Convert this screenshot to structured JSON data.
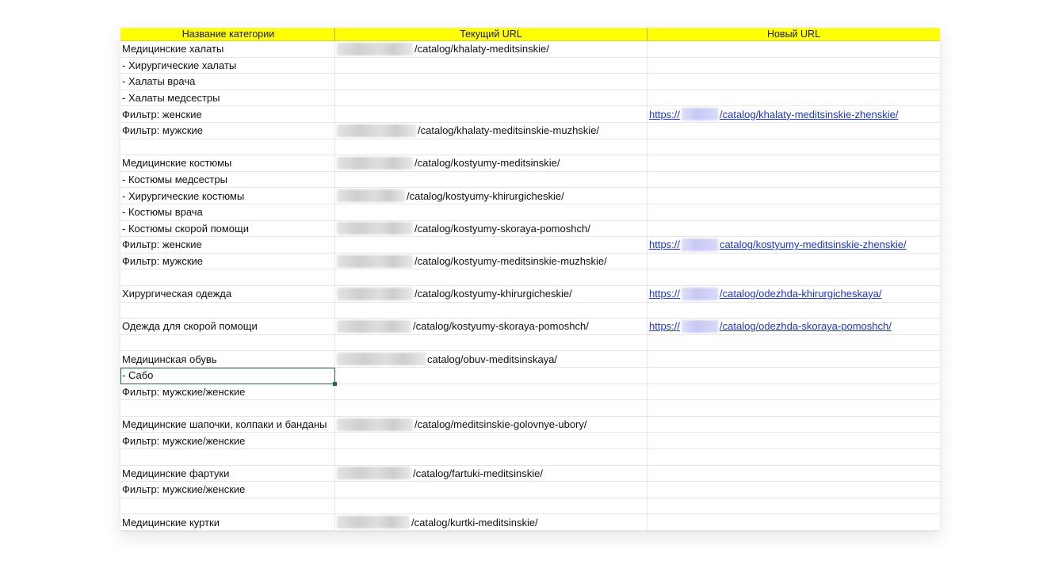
{
  "headers": {
    "col1": "Название категории",
    "col2": "Текущий URL",
    "col3": "Новый URL"
  },
  "rows": [
    {
      "name": "Медицинские халаты",
      "current_url": "/catalog/khalaty-meditsinskie/",
      "new_url": ""
    },
    {
      "name": " - Хирургические халаты",
      "current_url": "",
      "new_url": ""
    },
    {
      "name": " - Халаты врача",
      "current_url": "",
      "new_url": ""
    },
    {
      "name": " - Халаты медсестры",
      "current_url": "",
      "new_url": ""
    },
    {
      "name": "Фильтр: женские",
      "current_url": "",
      "new_url_prefix": "https://",
      "new_url": "/catalog/khalaty-meditsinskie-zhenskie/"
    },
    {
      "name": "Фильтр: мужские",
      "current_url": "/catalog/khalaty-meditsinskie-muzhskie/",
      "new_url": ""
    },
    {
      "name": "",
      "current_url": "",
      "new_url": ""
    },
    {
      "name": "Медицинские костюмы",
      "current_url": "/catalog/kostyumy-meditsinskie/",
      "new_url": ""
    },
    {
      "name": " - Костюмы медсестры",
      "current_url": "",
      "new_url": ""
    },
    {
      "name": " - Хирургические костюмы",
      "current_url": "/catalog/kostyumy-khirurgicheskie/",
      "new_url": ""
    },
    {
      "name": " - Костюмы врача",
      "current_url": "",
      "new_url": ""
    },
    {
      "name": " - Костюмы скорой помощи",
      "current_url": "/catalog/kostyumy-skoraya-pomoshch/",
      "new_url": ""
    },
    {
      "name": "Фильтр: женские",
      "current_url": "",
      "new_url_prefix": "https://",
      "new_url": "catalog/kostyumy-meditsinskie-zhenskie/"
    },
    {
      "name": "Фильтр: мужские",
      "current_url": "/catalog/kostyumy-meditsinskie-muzhskie/",
      "new_url": ""
    },
    {
      "name": "",
      "current_url": "",
      "new_url": ""
    },
    {
      "name": "Хирургическая одежда",
      "current_url": "/catalog/kostyumy-khirurgicheskie/",
      "new_url_prefix": "https://",
      "new_url": "/catalog/odezhda-khirurgicheskaya/"
    },
    {
      "name": "",
      "current_url": "",
      "new_url": ""
    },
    {
      "name": "Одежда для скорой помощи",
      "current_url": "/catalog/kostyumy-skoraya-pomoshch/",
      "new_url_prefix": "https://",
      "new_url": "/catalog/odezhda-skoraya-pomoshch/"
    },
    {
      "name": "",
      "current_url": "",
      "new_url": ""
    },
    {
      "name": "Медицинская обувь",
      "current_url": "catalog/obuv-meditsinskaya/",
      "new_url": ""
    },
    {
      "name": " - Сабо",
      "current_url": "",
      "new_url": ""
    },
    {
      "name": "Фильтр: мужские/женские",
      "current_url": "",
      "new_url": ""
    },
    {
      "name": "",
      "current_url": "",
      "new_url": ""
    },
    {
      "name": "Медицинские шапочки, колпаки и банданы",
      "current_url": "/catalog/meditsinskie-golovnye-ubory/",
      "new_url": ""
    },
    {
      "name": "Фильтр: мужские/женские",
      "current_url": "",
      "new_url": ""
    },
    {
      "name": "",
      "current_url": "",
      "new_url": ""
    },
    {
      "name": "Медицинские фартуки",
      "current_url": "/catalog/fartuki-meditsinskie/",
      "new_url": ""
    },
    {
      "name": "Фильтр: мужские/женские",
      "current_url": "",
      "new_url": ""
    },
    {
      "name": "",
      "current_url": "",
      "new_url": ""
    },
    {
      "name": "Медицинские куртки",
      "current_url": "/catalog/kurtki-meditsinskie/",
      "new_url": ""
    }
  ],
  "colors": {
    "header_bg": "#ffff00",
    "link": "#1a35d6",
    "selection": "#1e6e3c"
  }
}
